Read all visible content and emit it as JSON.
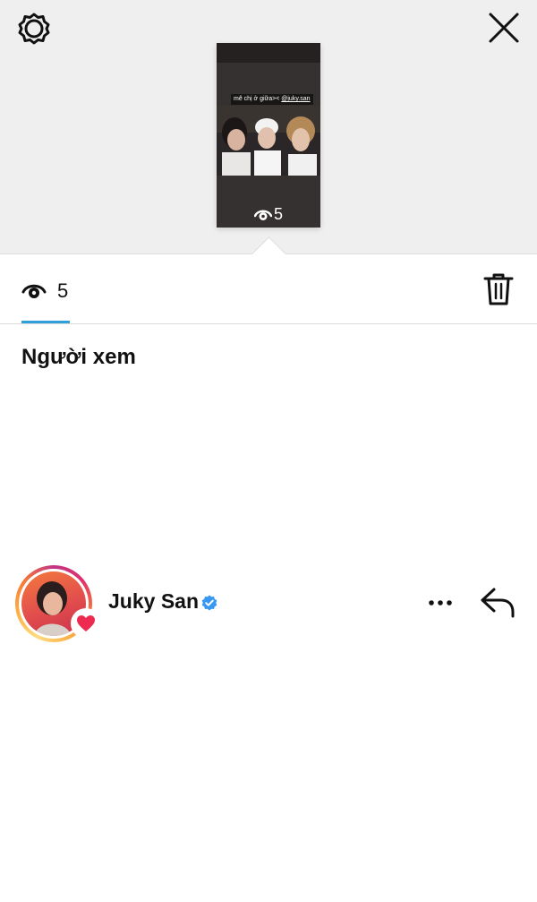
{
  "header": {
    "settings_icon": "gear-icon",
    "close_icon": "close-icon"
  },
  "story": {
    "caption_text": "mê chị ở giữa><",
    "caption_mention": "@juky.san",
    "view_count": "5"
  },
  "tabs": {
    "views_count": "5",
    "views_icon": "eye-icon",
    "delete_icon": "trash-icon"
  },
  "section": {
    "title": "Người xem"
  },
  "viewers": [
    {
      "name": "Juky San",
      "verified": true,
      "reaction": "heart",
      "more_icon": "more-icon",
      "reply_icon": "reply-icon"
    }
  ],
  "colors": {
    "tab_indicator": "#2e9fd8",
    "verified_badge": "#3897f0",
    "heart": "#ed2a4f"
  }
}
